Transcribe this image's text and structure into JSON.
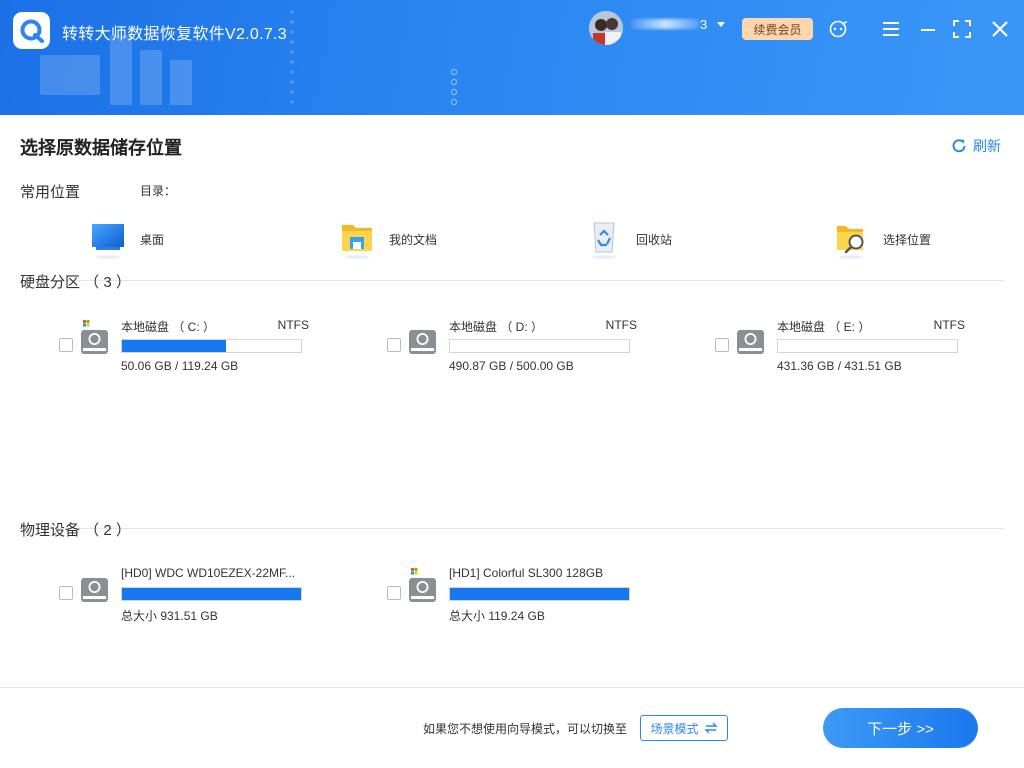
{
  "app": {
    "title": "转转大师数据恢复软件V2.0.7.3",
    "username_suffix": "3",
    "vip_label": "续费会员"
  },
  "icons": {
    "logo": "app-logo-magnifier",
    "caret": "chevron-down-icon",
    "support": "customer-service-icon",
    "menu": "menu-icon",
    "minimize": "minimize-icon",
    "maximize": "maximize-icon",
    "close": "close-icon",
    "refresh": "refresh-icon",
    "swap": "swap-icon"
  },
  "main": {
    "title": "选择原数据储存位置",
    "refresh_label": "刷新"
  },
  "common": {
    "title": "常用位置",
    "dir_label": "目录：",
    "items": [
      {
        "label": "桌面",
        "icon": "desktop-icon"
      },
      {
        "label": "我的文档",
        "icon": "documents-folder-icon"
      },
      {
        "label": "回收站",
        "icon": "recycle-bin-icon"
      },
      {
        "label": "选择位置",
        "icon": "choose-location-icon"
      }
    ]
  },
  "partitions": {
    "title": "硬盘分区 （ 3 ）",
    "drives": [
      {
        "name": "本地磁盘 （ C: ）",
        "fs": "NTFS",
        "size": "50.06 GB / 119.24 GB",
        "used_fraction": 0.58,
        "system": true
      },
      {
        "name": "本地磁盘 （ D: ）",
        "fs": "NTFS",
        "size": "490.87 GB / 500.00 GB",
        "used_fraction": 0.0,
        "system": false
      },
      {
        "name": "本地磁盘 （ E: ）",
        "fs": "NTFS",
        "size": "431.36 GB / 431.51 GB",
        "used_fraction": 0.0,
        "system": false
      }
    ]
  },
  "physical": {
    "title": "物理设备 （ 2 ）",
    "devices": [
      {
        "name": "[HD0] WDC WD10EZEX-22MF...",
        "size": "总大小 931.51 GB",
        "used_fraction": 1.0,
        "system": false
      },
      {
        "name": "[HD1] Colorful SL300 128GB",
        "size": "总大小 119.24 GB",
        "used_fraction": 1.0,
        "system": true
      }
    ]
  },
  "footer": {
    "hint": "如果您不想使用向导模式，可以切换至",
    "scene_label": "场景模式",
    "next_label": "下一步 >>"
  },
  "colors": {
    "header_blue": "#2a86f2",
    "accent": "#2b86f1",
    "bar_fill": "#1677ee",
    "vip_bg": "#fbd7b0"
  }
}
